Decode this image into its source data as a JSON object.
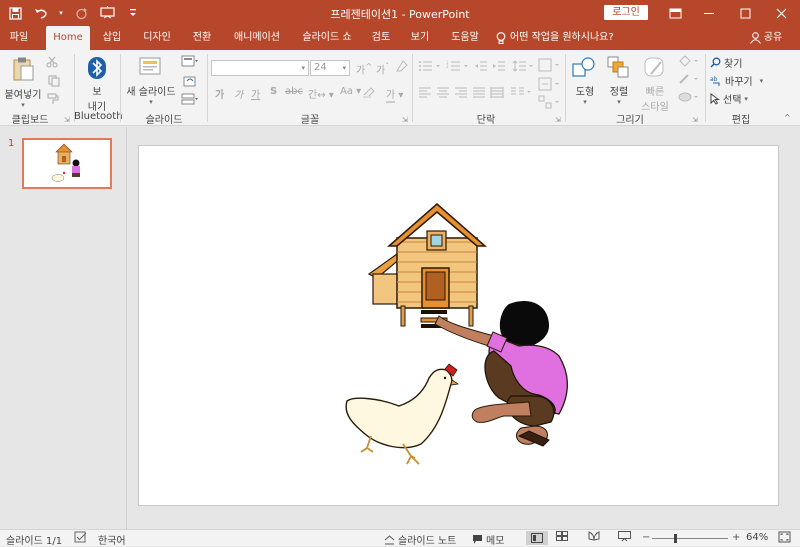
{
  "titlebar": {
    "title": "프레젠테이션1 - PowerPoint",
    "login_label": "로그인",
    "qat": [
      "save-icon",
      "undo-icon",
      "redo-icon",
      "slideshow-from-start-icon",
      "customize-icon"
    ]
  },
  "tabs": [
    {
      "label": "파일"
    },
    {
      "label": "Home"
    },
    {
      "label": "삽입"
    },
    {
      "label": "디자인"
    },
    {
      "label": "전환"
    },
    {
      "label": "애니메이션"
    },
    {
      "label": "슬라이드 쇼"
    },
    {
      "label": "검토"
    },
    {
      "label": "보기"
    },
    {
      "label": "도움말"
    }
  ],
  "tell_me": "어떤 작업을 원하시나요?",
  "share": "공유",
  "ribbon": {
    "paste": "붙여넣기",
    "clipboard_group": "클립보드",
    "bluetooth_btn": "보\n내기",
    "bluetooth_btn_line1": "보",
    "bluetooth_btn_line2": "내기",
    "bluetooth_group": "Bluetooth",
    "new_slide": "새 슬라이드",
    "slides_group": "슬라이드",
    "font_size": "24",
    "font_group": "글꼴",
    "paragraph_group": "단락",
    "shape": "도형",
    "arrange": "정렬",
    "quick_style_line1": "빠른",
    "quick_style_line2": "스타일",
    "drawing_group": "그리기",
    "find": "찾기",
    "replace": "바꾸기",
    "select": "선택",
    "editing_group": "편집",
    "font_glyphs": {
      "bold": "가",
      "italic": "가",
      "underline": "가",
      "strike": "S",
      "abc": "abc",
      "spacing": "간",
      "aa": "Aa",
      "grow": "가",
      "shrink": "가",
      "clear": "가",
      "highlight": "가"
    }
  },
  "slides": [
    {
      "number": "1"
    }
  ],
  "status": {
    "slide_info": "슬라이드 1/1",
    "language": "한국어",
    "notes": "슬라이드 노트",
    "comments": "메모",
    "zoom": "64%",
    "zoom_minus": "−",
    "zoom_plus": "+"
  },
  "colors": {
    "accent": "#b7472a",
    "ribbon_bg": "#f3f3f3",
    "workspace_bg": "#e6e6e6",
    "thumb_border": "#e07a5a"
  }
}
